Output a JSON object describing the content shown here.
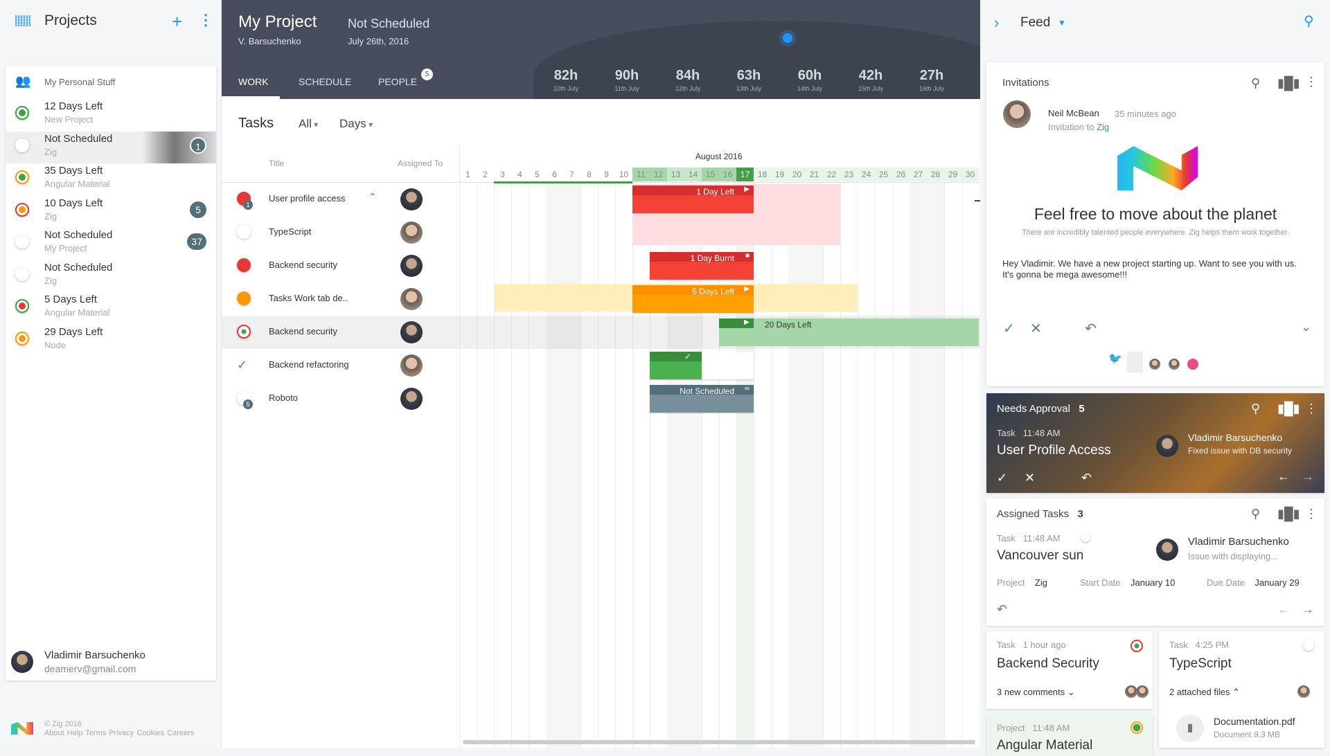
{
  "sidebar": {
    "title": "Projects",
    "section": "My Personal Stuff",
    "projects": [
      {
        "status": "12 Days Left",
        "project": "New Project",
        "dot": "#43a047",
        "ring": "#43a047"
      },
      {
        "status": "Not Scheduled",
        "project": "Zig",
        "badge": "1",
        "dot": "#ffffff",
        "ring": "#fff"
      },
      {
        "status": "35 Days Left",
        "project": "Angular Material",
        "dot": "#43a047",
        "ring": "#ffa000"
      },
      {
        "status": "10 Days Left",
        "project": "Zig",
        "badge": "5",
        "dot": "#ff9800",
        "ring": "#e53935"
      },
      {
        "status": "Not Scheduled",
        "project": "My Project",
        "badge": "37",
        "dot": "#ffffff",
        "ring": "#fff"
      },
      {
        "status": "Not Scheduled",
        "project": "Zig",
        "dot": "#ffffff",
        "ring": "#fff"
      },
      {
        "status": "5 Days Left",
        "project": "Angular Material",
        "dot": "#e53935",
        "ring": "#43a047"
      },
      {
        "status": "29 Days Left",
        "project": "Node",
        "dot": "#ff9800",
        "ring": "#ffa000"
      }
    ],
    "user": {
      "name": "Vladimir Barsuchenko",
      "email": "deamerv@gmail.com"
    },
    "footer": {
      "copyright": "© Zig 2016",
      "links": [
        "About",
        "Help",
        "Terms",
        "Privacy",
        "Cookies",
        "Careers"
      ]
    }
  },
  "header": {
    "title": "My Project",
    "status": "Not Scheduled",
    "owner": "V. Barsuchenko",
    "date": "July 26th, 2016",
    "tabs": [
      "WORK",
      "SCHEDULE",
      "PEOPLE"
    ],
    "people_count": "5",
    "hours": [
      {
        "h": "82h",
        "d": "10th July"
      },
      {
        "h": "90h",
        "d": "11th July"
      },
      {
        "h": "84h",
        "d": "12th July"
      },
      {
        "h": "63h",
        "d": "13th July"
      },
      {
        "h": "60h",
        "d": "14th July"
      },
      {
        "h": "42h",
        "d": "15th July"
      },
      {
        "h": "27h",
        "d": "16th July"
      }
    ]
  },
  "tasks": {
    "title": "Tasks",
    "filter": "All",
    "scale": "Days",
    "col_title": "Title",
    "col_assigned": "Assigned To",
    "month": "August 2016",
    "today": 17,
    "rows": [
      {
        "name": "User profile access",
        "status_color": "#e53935",
        "count": "1",
        "bar": {
          "start": 11,
          "end": 17,
          "label": "1 Day Left",
          "color": "#f44336",
          "head": "#d32f2f"
        },
        "zone": {
          "start": 11,
          "end": 22,
          "color": "#ffdde1"
        }
      },
      {
        "name": "TypeScript",
        "status_color": "#ffffff"
      },
      {
        "name": "Backend security",
        "status_color": "#e53935",
        "bar": {
          "start": 12,
          "end": 17,
          "label": "1 Day Burnt",
          "color": "#f44336",
          "head": "#d32f2f"
        }
      },
      {
        "name": "Tasks Work tab de..",
        "status_color": "#ff9800",
        "bar": {
          "start": 11,
          "end": 17,
          "label": "5 Days Left",
          "color": "#ffa000",
          "head": "#ff8f00"
        },
        "zone": {
          "start": 3,
          "end": 23,
          "color": "#ffeeba"
        }
      },
      {
        "name": "Backend security",
        "status_color": "#e53935",
        "bar": {
          "start": 16,
          "end": 30,
          "label": "20 Days Left",
          "color": "#a5d6a7",
          "head": "#388e3c"
        }
      },
      {
        "name": "Backend refactoring",
        "status_color": "#43a047",
        "bar": {
          "start": 12,
          "end": 17,
          "label": "",
          "color": "#ffffff",
          "head": "#388e3c"
        }
      },
      {
        "name": "Roboto",
        "status_color": "#ffffff",
        "count": "5",
        "bar": {
          "start": 12,
          "end": 17,
          "label": "Not Scheduled",
          "color": "#78909c",
          "head": "#546e7a"
        }
      }
    ]
  },
  "feed": {
    "title": "Feed",
    "invitations": {
      "title": "Invitations",
      "from": "Neil McBean",
      "time": "35 minutes ago",
      "invite_prefix": "Invitation to",
      "invite_project": "Zig",
      "headline": "Feel free to move about the planet",
      "tagline": "There are incredibly talented people everywhere. Zig helps them work together.",
      "message": "Hey Vladimir. We have a new project starting up. Want to see you with us. It's gonna be mega awesome!!!"
    },
    "approval": {
      "title": "Needs Approval",
      "count": "5",
      "type": "Task",
      "time": "11:48 AM",
      "task": "User Profile Access",
      "user": "Vladimir Barsuchenko",
      "note": "Fixed issue with DB security"
    },
    "assigned": {
      "title": "Assigned Tasks",
      "count": "3",
      "type": "Task",
      "time": "11:48 AM",
      "task": "Vancouver sun",
      "user": "Vladimir Barsuchenko",
      "note": "Issue with displaying...",
      "project_label": "Project",
      "project": "Zig",
      "start_label": "Start Date",
      "start": "January 10",
      "due_label": "Due Date",
      "due": "January 29"
    },
    "small1": {
      "type": "Task",
      "time": "1 hour ago",
      "task": "Backend Security",
      "extra": "3 new comments"
    },
    "small2": {
      "type": "Task",
      "time": "4:25 PM",
      "task": "TypeScript",
      "extra": "2 attached files",
      "file": "Documentation.pdf",
      "file_meta": "Document 9.3 MB"
    },
    "small3": {
      "type": "Project",
      "time": "11:48 AM",
      "task": "Angular Material"
    }
  }
}
